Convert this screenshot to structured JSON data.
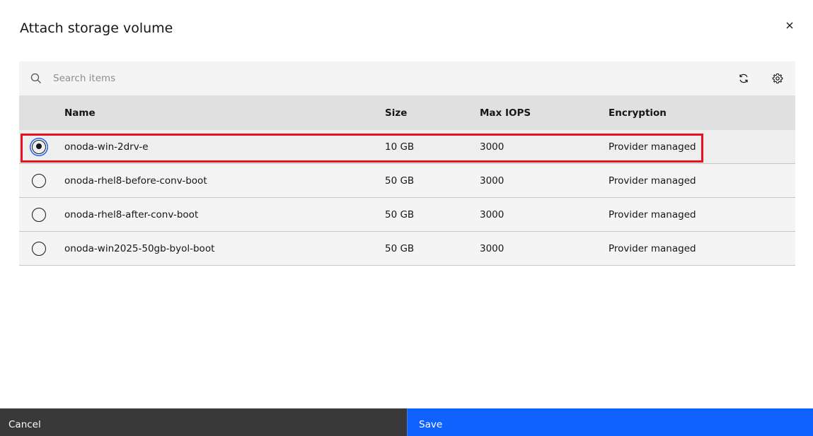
{
  "modal": {
    "title": "Attach storage volume"
  },
  "toolbar": {
    "search_placeholder": "Search items",
    "refresh_icon": "refresh-icon",
    "settings_icon": "gear-icon"
  },
  "table": {
    "columns": [
      "Name",
      "Size",
      "Max IOPS",
      "Encryption"
    ],
    "rows": [
      {
        "name": "onoda-win-2drv-e",
        "size": "10 GB",
        "iops": "3000",
        "encryption": "Provider managed",
        "selected": true
      },
      {
        "name": "onoda-rhel8-before-conv-boot",
        "size": "50 GB",
        "iops": "3000",
        "encryption": "Provider managed",
        "selected": false
      },
      {
        "name": "onoda-rhel8-after-conv-boot",
        "size": "50 GB",
        "iops": "3000",
        "encryption": "Provider managed",
        "selected": false
      },
      {
        "name": "onoda-win2025-50gb-byol-boot",
        "size": "50 GB",
        "iops": "3000",
        "encryption": "Provider managed",
        "selected": false
      }
    ]
  },
  "footer": {
    "cancel_label": "Cancel",
    "save_label": "Save"
  },
  "colors": {
    "primary": "#0f62fe",
    "secondary": "#393939",
    "highlight": "#e8121f"
  }
}
